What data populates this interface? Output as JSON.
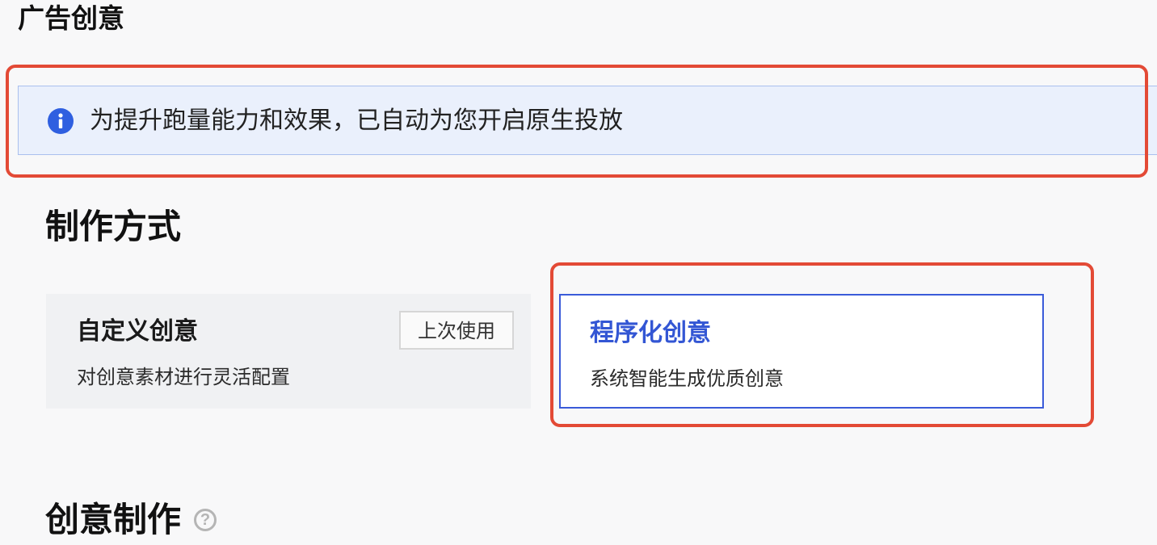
{
  "page": {
    "section_title": "广告创意"
  },
  "notice": {
    "icon": "info-icon",
    "text": "为提升跑量能力和效果，已自动为您开启原生投放"
  },
  "method": {
    "heading": "制作方式",
    "cards": [
      {
        "title": "自定义创意",
        "description": "对创意素材进行灵活配置",
        "badge": "上次使用",
        "selected": false
      },
      {
        "title": "程序化创意",
        "description": "系统智能生成优质创意",
        "selected": true
      }
    ]
  },
  "creation": {
    "heading": "创意制作",
    "help_icon": "question-circle-icon"
  },
  "colors": {
    "accent": "#3356d4",
    "notice_bg": "#eaf0fc",
    "annotation": "#e34a36"
  }
}
